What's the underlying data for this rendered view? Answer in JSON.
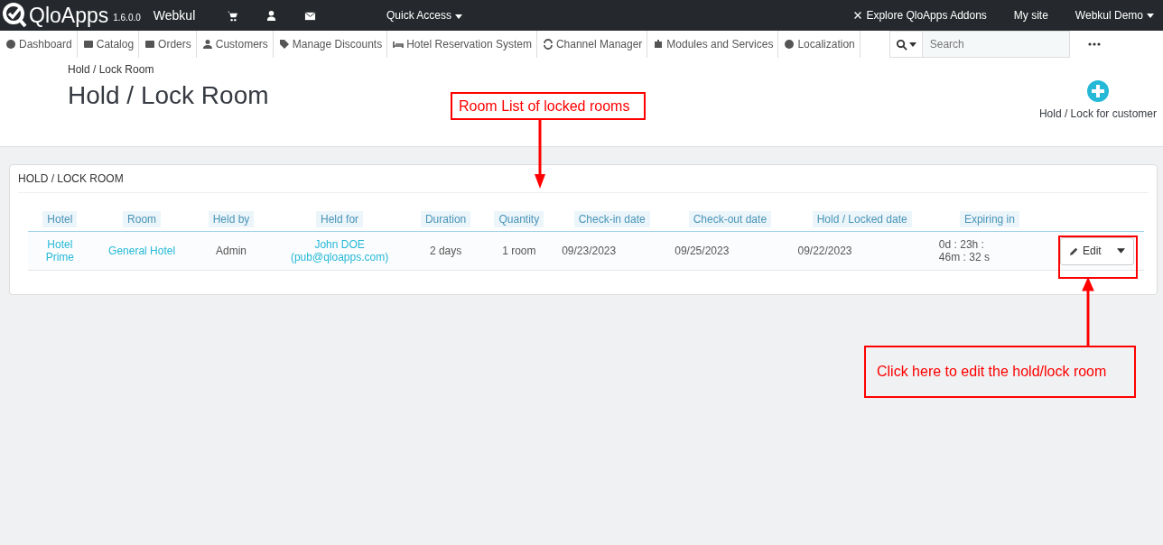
{
  "topbar": {
    "logo": "QloApps",
    "version": "1.6.0.0",
    "shop": "Webkul",
    "quick_access": "Quick Access",
    "addons": "Explore QloApps Addons",
    "my_site": "My site",
    "user": "Webkul Demo"
  },
  "nav": [
    {
      "label": "Dashboard"
    },
    {
      "label": "Catalog"
    },
    {
      "label": "Orders"
    },
    {
      "label": "Customers"
    },
    {
      "label": "Manage Discounts"
    },
    {
      "label": "Hotel Reservation System"
    },
    {
      "label": "Channel Manager"
    },
    {
      "label": "Modules and Services"
    },
    {
      "label": "Localization"
    }
  ],
  "search": {
    "placeholder": "Search"
  },
  "header": {
    "breadcrumb": "Hold / Lock Room",
    "title": "Hold / Lock Room",
    "action": "Hold / Lock for customer"
  },
  "panel": {
    "title": "HOLD / LOCK ROOM",
    "columns": [
      "Hotel",
      "Room",
      "Held by",
      "Held for",
      "Duration",
      "Quantity",
      "Check-in date",
      "Check-out date",
      "Hold / Locked date",
      "Expiring in"
    ],
    "rows": [
      {
        "hotel": "Hotel Prime",
        "room": "General Hotel",
        "held_by": "Admin",
        "held_for": "John DOE",
        "email": "(pub@qloapps.com)",
        "duration": "2 days",
        "quantity": "1 room",
        "check_in": "09/23/2023",
        "check_out": "09/25/2023",
        "locked": "09/22/2023",
        "expiring": "0d : 23h : 46m : 32 s",
        "action": "Edit"
      }
    ]
  },
  "annotations": [
    {
      "text": "Room List of locked rooms"
    },
    {
      "text": "Click here to edit the hold/lock room"
    }
  ]
}
